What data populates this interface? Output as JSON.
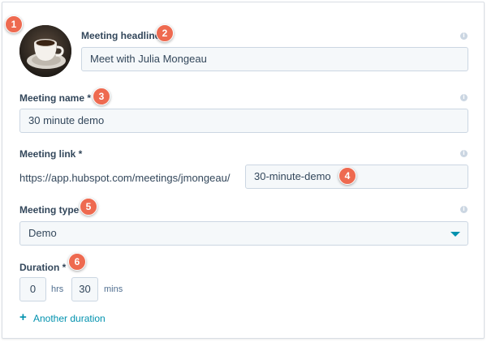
{
  "headline": {
    "label": "Meeting headline",
    "value": "Meet with Julia Mongeau"
  },
  "name": {
    "label": "Meeting name *",
    "value": "30 minute demo"
  },
  "link": {
    "label": "Meeting link *",
    "prefix": "https://app.hubspot.com/meetings/jmongeau/",
    "slug": "30-minute-demo"
  },
  "type": {
    "label": "Meeting type",
    "value": "Demo"
  },
  "duration": {
    "label": "Duration *",
    "hours": "0",
    "hours_unit": "hrs",
    "minutes": "30",
    "minutes_unit": "mins",
    "add_label": "Another duration"
  },
  "info_glyph": "i",
  "markers": [
    "1",
    "2",
    "3",
    "4",
    "5",
    "6"
  ],
  "colors": {
    "accent": "#0091ae",
    "marker": "#ee6a50",
    "field_bg": "#f5f8fa",
    "border": "#cbd6e2"
  }
}
